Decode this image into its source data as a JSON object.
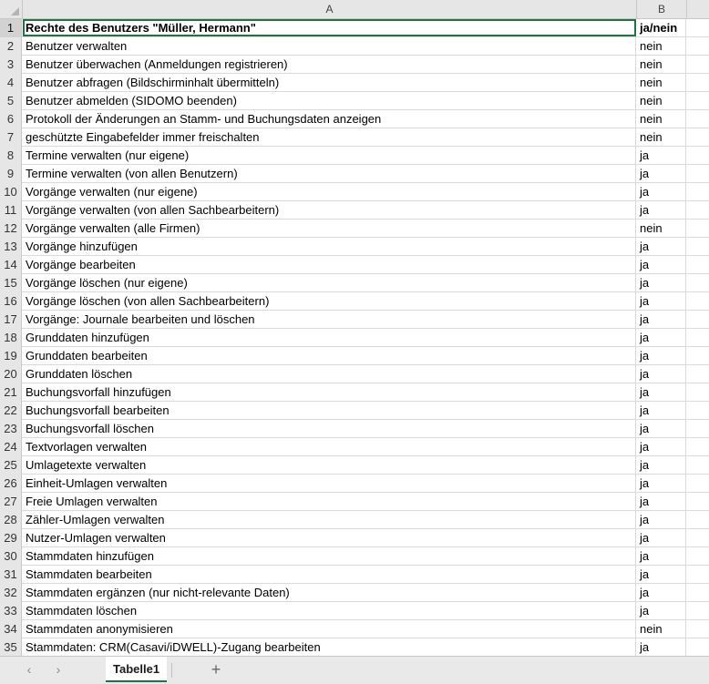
{
  "columns": {
    "a": "A",
    "b": "B"
  },
  "rows": [
    {
      "num": "1",
      "a": "Rechte des Benutzers \"Müller, Hermann\"",
      "b": "ja/nein"
    },
    {
      "num": "2",
      "a": "Benutzer verwalten",
      "b": "nein"
    },
    {
      "num": "3",
      "a": "Benutzer überwachen (Anmeldungen registrieren)",
      "b": "nein"
    },
    {
      "num": "4",
      "a": "Benutzer abfragen (Bildschirminhalt übermitteln)",
      "b": "nein"
    },
    {
      "num": "5",
      "a": "Benutzer abmelden (SIDOMO beenden)",
      "b": "nein"
    },
    {
      "num": "6",
      "a": "Protokoll der Änderungen an Stamm- und Buchungsdaten anzeigen",
      "b": "nein"
    },
    {
      "num": "7",
      "a": "geschützte Eingabefelder immer freischalten",
      "b": "nein"
    },
    {
      "num": "8",
      "a": "Termine verwalten (nur eigene)",
      "b": "ja"
    },
    {
      "num": "9",
      "a": "Termine verwalten (von allen Benutzern)",
      "b": "ja"
    },
    {
      "num": "10",
      "a": "Vorgänge verwalten (nur eigene)",
      "b": "ja"
    },
    {
      "num": "11",
      "a": "Vorgänge verwalten (von allen Sachbearbeitern)",
      "b": "ja"
    },
    {
      "num": "12",
      "a": "Vorgänge verwalten (alle Firmen)",
      "b": "nein"
    },
    {
      "num": "13",
      "a": "Vorgänge hinzufügen",
      "b": "ja"
    },
    {
      "num": "14",
      "a": "Vorgänge bearbeiten",
      "b": "ja"
    },
    {
      "num": "15",
      "a": "Vorgänge löschen (nur eigene)",
      "b": "ja"
    },
    {
      "num": "16",
      "a": "Vorgänge löschen (von allen Sachbearbeitern)",
      "b": "ja"
    },
    {
      "num": "17",
      "a": "Vorgänge: Journale bearbeiten und löschen",
      "b": "ja"
    },
    {
      "num": "18",
      "a": "Grunddaten hinzufügen",
      "b": "ja"
    },
    {
      "num": "19",
      "a": "Grunddaten bearbeiten",
      "b": "ja"
    },
    {
      "num": "20",
      "a": "Grunddaten löschen",
      "b": "ja"
    },
    {
      "num": "21",
      "a": "Buchungsvorfall hinzufügen",
      "b": "ja"
    },
    {
      "num": "22",
      "a": "Buchungsvorfall bearbeiten",
      "b": "ja"
    },
    {
      "num": "23",
      "a": "Buchungsvorfall löschen",
      "b": "ja"
    },
    {
      "num": "24",
      "a": "Textvorlagen verwalten",
      "b": "ja"
    },
    {
      "num": "25",
      "a": "Umlagetexte verwalten",
      "b": "ja"
    },
    {
      "num": "26",
      "a": "Einheit-Umlagen verwalten",
      "b": "ja"
    },
    {
      "num": "27",
      "a": "Freie Umlagen verwalten",
      "b": "ja"
    },
    {
      "num": "28",
      "a": "Zähler-Umlagen verwalten",
      "b": "ja"
    },
    {
      "num": "29",
      "a": "Nutzer-Umlagen verwalten",
      "b": "ja"
    },
    {
      "num": "30",
      "a": "Stammdaten hinzufügen",
      "b": "ja"
    },
    {
      "num": "31",
      "a": "Stammdaten bearbeiten",
      "b": "ja"
    },
    {
      "num": "32",
      "a": "Stammdaten ergänzen (nur nicht-relevante Daten)",
      "b": "ja"
    },
    {
      "num": "33",
      "a": "Stammdaten löschen",
      "b": "ja"
    },
    {
      "num": "34",
      "a": "Stammdaten anonymisieren",
      "b": "nein"
    },
    {
      "num": "35",
      "a": "Stammdaten: CRM(Casavi/iDWELL)-Zugang bearbeiten",
      "b": "ja"
    }
  ],
  "tabbar": {
    "prev_icon": "chevron-left-icon",
    "next_icon": "chevron-right-icon",
    "active_tab": "Tabelle1",
    "add_icon": "plus-icon"
  },
  "colors": {
    "selection": "#217346",
    "header_bg": "#e6e6e6"
  }
}
